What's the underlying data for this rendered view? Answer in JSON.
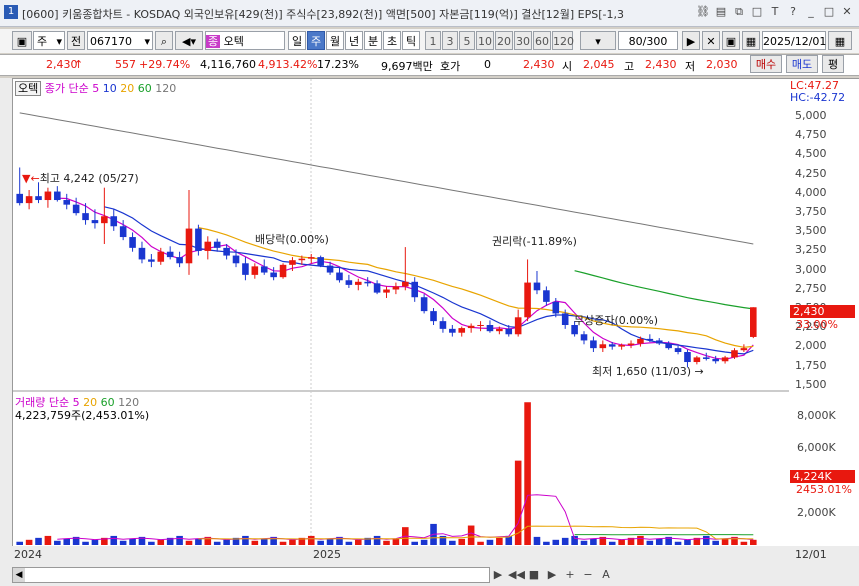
{
  "titlebar": {
    "number": "1",
    "title": "[0600] 키움종합차트 - KOSDAQ 외국인보유[429(천)] 주식수[23,892(천)] 액면[500] 자본금[119(억)] 결산[12월] EPS[-1,3"
  },
  "toolbar": {
    "menu_label": "주",
    "prev_label": "전",
    "code": "067170",
    "stock_name": "오텍",
    "stock_badge": "종",
    "periods": [
      "일",
      "주",
      "월",
      "년",
      "분",
      "초",
      "틱"
    ],
    "selected_period": "주",
    "intervals": [
      "1",
      "3",
      "5",
      "10",
      "20",
      "30",
      "60",
      "120"
    ],
    "count": "80/300",
    "date": "2025/12/01"
  },
  "quote": {
    "price": "2,430",
    "arrow": "↑",
    "change": "557",
    "change_pct": "+29.74%",
    "volume": "4,116,760",
    "vol_ratio": "4,913.42%",
    "turnover": "17.23%",
    "amount": "9,697백만",
    "hoga_label": "호가",
    "hoga_value": "0",
    "hoga_price": "2,430",
    "open_label": "시",
    "open": "2,045",
    "high_label": "고",
    "high": "2,430",
    "low_label": "저",
    "low": "2,030",
    "buy_label": "매수",
    "sell_label": "매도",
    "eval_label": "평"
  },
  "legend_price": {
    "name": "오텍",
    "type": "종가 단순",
    "periods": [
      "5",
      "10",
      "20",
      "60",
      "120"
    ]
  },
  "legend_volume": {
    "type": "거래량 단순",
    "periods": [
      "5",
      "20",
      "60",
      "120"
    ],
    "value": "4,223,759주(2,453.01%)"
  },
  "annotations": {
    "high": "최고 4,242 (05/27)",
    "dividend": "배당락(0.00%)",
    "rights": "권리락(-11.89%)",
    "free_issue": "무상증자(0.00%)",
    "low": "최저 1,650 (11/03)"
  },
  "axis": {
    "lc": "LC:47.27",
    "hc": "HC:-42.72",
    "price_ticks": [
      "5,000",
      "4,750",
      "4,500",
      "4,250",
      "4,000",
      "3,750",
      "3,500",
      "3,250",
      "3,000",
      "2,750",
      "2,500",
      "2,250",
      "2,000",
      "1,750",
      "1,500"
    ],
    "current_price": "2,430",
    "current_pct": "33.00%",
    "volume_ticks": [
      "8,000K",
      "6,000K",
      "2,000K"
    ],
    "current_vol": "4,224K",
    "current_vol_pct": "2453.01%",
    "x_labels": [
      "2024",
      "2025",
      "12/01"
    ]
  },
  "colors": {
    "up": "#e8180f",
    "down": "#1a36d0",
    "ma5": "#cc00cc",
    "ma10": "#1a36d0",
    "ma20": "#e8a400",
    "ma60": "#1aa02a",
    "ma120": "#777777"
  },
  "chart_data": {
    "type": "candlestick",
    "price_ylim": [
      1500,
      5000
    ],
    "volume_ylim": [
      0,
      9000
    ],
    "x_labels": [
      "2024",
      "2025",
      "12/01"
    ],
    "candles": [
      [
        3900,
        4242,
        3750,
        3780
      ],
      [
        3780,
        3950,
        3700,
        3870
      ],
      [
        3870,
        4050,
        3780,
        3820
      ],
      [
        3820,
        3980,
        3720,
        3930
      ],
      [
        3930,
        4000,
        3800,
        3820
      ],
      [
        3820,
        3900,
        3700,
        3760
      ],
      [
        3760,
        3850,
        3620,
        3650
      ],
      [
        3650,
        3780,
        3500,
        3560
      ],
      [
        3560,
        3700,
        3450,
        3520
      ],
      [
        3520,
        3980,
        3250,
        3610
      ],
      [
        3610,
        3700,
        3420,
        3480
      ],
      [
        3480,
        3560,
        3300,
        3340
      ],
      [
        3340,
        3400,
        3150,
        3200
      ],
      [
        3200,
        3280,
        3000,
        3050
      ],
      [
        3050,
        3120,
        2950,
        3020
      ],
      [
        3020,
        3200,
        2980,
        3150
      ],
      [
        3150,
        3220,
        3050,
        3080
      ],
      [
        3080,
        3150,
        2950,
        3000
      ],
      [
        3000,
        3950,
        2850,
        3450
      ],
      [
        3450,
        3500,
        3100,
        3160
      ],
      [
        3160,
        3350,
        3050,
        3280
      ],
      [
        3280,
        3320,
        3150,
        3200
      ],
      [
        3200,
        3250,
        3050,
        3100
      ],
      [
        3100,
        3180,
        2950,
        3000
      ],
      [
        3000,
        3080,
        2780,
        2850
      ],
      [
        2850,
        3000,
        2800,
        2960
      ],
      [
        2960,
        3050,
        2850,
        2880
      ],
      [
        2880,
        2950,
        2780,
        2820
      ],
      [
        2820,
        3000,
        2800,
        2980
      ],
      [
        2980,
        3080,
        2900,
        3040
      ],
      [
        3040,
        3100,
        2980,
        3060
      ],
      [
        3060,
        3120,
        3000,
        3080
      ],
      [
        3080,
        3100,
        2950,
        2970
      ],
      [
        2970,
        3020,
        2850,
        2880
      ],
      [
        2880,
        2950,
        2750,
        2780
      ],
      [
        2780,
        2850,
        2680,
        2720
      ],
      [
        2720,
        2800,
        2650,
        2760
      ],
      [
        2760,
        2820,
        2700,
        2740
      ],
      [
        2740,
        2780,
        2600,
        2620
      ],
      [
        2620,
        2700,
        2550,
        2660
      ],
      [
        2660,
        2750,
        2600,
        2700
      ],
      [
        2700,
        3210,
        2650,
        2760
      ],
      [
        2760,
        2820,
        2500,
        2560
      ],
      [
        2560,
        2600,
        2350,
        2380
      ],
      [
        2380,
        2420,
        2200,
        2250
      ],
      [
        2250,
        2300,
        2100,
        2150
      ],
      [
        2150,
        2200,
        2050,
        2100
      ],
      [
        2100,
        2180,
        2050,
        2160
      ],
      [
        2160,
        2220,
        2100,
        2190
      ],
      [
        2190,
        2250,
        2120,
        2200
      ],
      [
        2200,
        2260,
        2100,
        2120
      ],
      [
        2120,
        2180,
        2080,
        2150
      ],
      [
        2150,
        2200,
        2050,
        2080
      ],
      [
        2080,
        2400,
        2050,
        2300
      ],
      [
        2300,
        3050,
        2250,
        2750
      ],
      [
        2750,
        2900,
        2600,
        2650
      ],
      [
        2650,
        2700,
        2450,
        2500
      ],
      [
        2500,
        2550,
        2300,
        2350
      ],
      [
        2350,
        2400,
        2150,
        2200
      ],
      [
        2200,
        2250,
        2050,
        2080
      ],
      [
        2080,
        2120,
        1950,
        2000
      ],
      [
        2000,
        2050,
        1850,
        1900
      ],
      [
        1900,
        2000,
        1850,
        1950
      ],
      [
        1950,
        1980,
        1880,
        1920
      ],
      [
        1920,
        1960,
        1880,
        1940
      ],
      [
        1940,
        2000,
        1900,
        1960
      ],
      [
        1960,
        2050,
        1920,
        2020
      ],
      [
        2020,
        2080,
        1980,
        2000
      ],
      [
        2000,
        2030,
        1940,
        1960
      ],
      [
        1960,
        1990,
        1880,
        1900
      ],
      [
        1900,
        1930,
        1820,
        1850
      ],
      [
        1850,
        1880,
        1650,
        1720
      ],
      [
        1720,
        1800,
        1690,
        1780
      ],
      [
        1780,
        1840,
        1740,
        1760
      ],
      [
        1760,
        1800,
        1700,
        1730
      ],
      [
        1730,
        1800,
        1700,
        1780
      ],
      [
        1780,
        1900,
        1760,
        1873
      ],
      [
        1873,
        1950,
        1850,
        1900
      ],
      [
        2045,
        2430,
        2030,
        2430
      ]
    ],
    "volume_spikes": {
      "41": 1100,
      "44": 1300,
      "48": 1200,
      "53": 5200,
      "54": 8800,
      "79": 4224
    }
  }
}
